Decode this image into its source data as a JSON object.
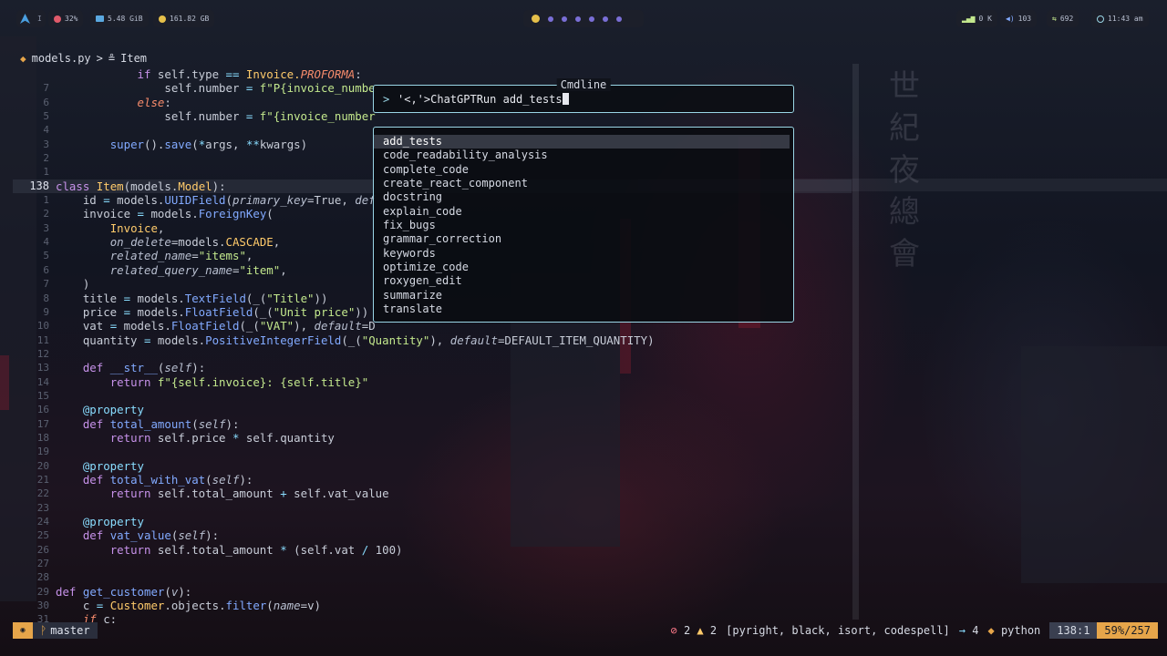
{
  "topbar": {
    "launcher_icon": "arch-logo",
    "workspace": "I",
    "cpu": "32%",
    "ram": "5.48 GiB",
    "disk": "161.82 GB",
    "net": "0 K",
    "volume": "103",
    "updates": "692",
    "clock": "11:43 am",
    "workspace_dots": 6
  },
  "winbar": {
    "file": "models.py",
    "separator": ">",
    "symbol_icon": "class-icon",
    "symbol": "Item"
  },
  "code_lines": [
    {
      "ln": "",
      "cur": false,
      "tokens": [
        [
          "            ",
          ""
        ],
        [
          "if",
          "kw"
        ],
        [
          " self.type ",
          ""
        ],
        [
          "==",
          "op"
        ],
        [
          " Invoice.",
          "cl"
        ],
        [
          "PROFORMA",
          "it"
        ],
        [
          ":",
          ""
        ]
      ]
    },
    {
      "ln": "7",
      "cur": false,
      "tokens": [
        [
          "                self.number ",
          ""
        ],
        [
          "=",
          "op"
        ],
        [
          " f\"P{invoice_numbe",
          "st"
        ]
      ]
    },
    {
      "ln": "6",
      "cur": false,
      "tokens": [
        [
          "            ",
          ""
        ],
        [
          "else",
          "it"
        ],
        [
          ":",
          ""
        ]
      ]
    },
    {
      "ln": "5",
      "cur": false,
      "tokens": [
        [
          "                self.number ",
          ""
        ],
        [
          "=",
          "op"
        ],
        [
          " f\"{invoice_number",
          "st"
        ]
      ]
    },
    {
      "ln": "4",
      "cur": false,
      "tokens": [
        [
          "",
          ""
        ]
      ]
    },
    {
      "ln": "3",
      "cur": false,
      "tokens": [
        [
          "        ",
          ""
        ],
        [
          "super",
          "fn"
        ],
        [
          "().",
          ""
        ],
        [
          "save",
          "fn"
        ],
        [
          "(",
          ""
        ],
        [
          "*",
          "op"
        ],
        [
          "args, ",
          ""
        ],
        [
          "**",
          "op"
        ],
        [
          "kwargs)",
          ""
        ]
      ]
    },
    {
      "ln": "2",
      "cur": false,
      "tokens": [
        [
          "",
          ""
        ]
      ]
    },
    {
      "ln": "1",
      "cur": false,
      "tokens": [
        [
          "",
          ""
        ]
      ]
    },
    {
      "ln": "138",
      "cur": true,
      "tokens": [
        [
          "class",
          "kw"
        ],
        [
          " ",
          ""
        ],
        [
          "Item",
          "cl"
        ],
        [
          "(models.",
          ""
        ],
        [
          "Model",
          "cl"
        ],
        [
          "):",
          ""
        ]
      ]
    },
    {
      "ln": "1",
      "cur": false,
      "tokens": [
        [
          "    id ",
          ""
        ],
        [
          "=",
          "op"
        ],
        [
          " models.",
          ""
        ],
        [
          "UUIDField",
          "fn"
        ],
        [
          "(",
          ""
        ],
        [
          "primary_key",
          "pa"
        ],
        [
          "=True, ",
          ""
        ],
        [
          "def",
          "pa"
        ]
      ]
    },
    {
      "ln": "2",
      "cur": false,
      "tokens": [
        [
          "    invoice ",
          ""
        ],
        [
          "=",
          "op"
        ],
        [
          " models.",
          ""
        ],
        [
          "ForeignKey",
          "fn"
        ],
        [
          "(",
          ""
        ]
      ]
    },
    {
      "ln": "3",
      "cur": false,
      "tokens": [
        [
          "        ",
          ""
        ],
        [
          "Invoice",
          "cl"
        ],
        [
          ",",
          ""
        ]
      ]
    },
    {
      "ln": "4",
      "cur": false,
      "tokens": [
        [
          "        ",
          ""
        ],
        [
          "on_delete",
          "pa"
        ],
        [
          "=models.",
          ""
        ],
        [
          "CASCADE",
          "cl"
        ],
        [
          ",",
          ""
        ]
      ]
    },
    {
      "ln": "5",
      "cur": false,
      "tokens": [
        [
          "        ",
          ""
        ],
        [
          "related_name",
          "pa"
        ],
        [
          "=",
          ""
        ],
        [
          "\"items\"",
          "st"
        ],
        [
          ",",
          ""
        ]
      ]
    },
    {
      "ln": "6",
      "cur": false,
      "tokens": [
        [
          "        ",
          ""
        ],
        [
          "related_query_name",
          "pa"
        ],
        [
          "=",
          ""
        ],
        [
          "\"item\"",
          "st"
        ],
        [
          ",",
          ""
        ]
      ]
    },
    {
      "ln": "7",
      "cur": false,
      "tokens": [
        [
          "    )",
          ""
        ]
      ]
    },
    {
      "ln": "8",
      "cur": false,
      "tokens": [
        [
          "    title ",
          ""
        ],
        [
          "=",
          "op"
        ],
        [
          " models.",
          ""
        ],
        [
          "TextField",
          "fn"
        ],
        [
          "(_(",
          ""
        ],
        [
          "\"Title\"",
          "st"
        ],
        [
          "))",
          ""
        ]
      ]
    },
    {
      "ln": "9",
      "cur": false,
      "tokens": [
        [
          "    price ",
          ""
        ],
        [
          "=",
          "op"
        ],
        [
          " models.",
          ""
        ],
        [
          "FloatField",
          "fn"
        ],
        [
          "(_(",
          ""
        ],
        [
          "\"Unit price\"",
          "st"
        ],
        [
          "))",
          ""
        ]
      ]
    },
    {
      "ln": "10",
      "cur": false,
      "tokens": [
        [
          "    vat ",
          ""
        ],
        [
          "=",
          "op"
        ],
        [
          " models.",
          ""
        ],
        [
          "FloatField",
          "fn"
        ],
        [
          "(_(",
          ""
        ],
        [
          "\"VAT\"",
          "st"
        ],
        [
          "), ",
          ""
        ],
        [
          "default",
          "pa"
        ],
        [
          "=D",
          ""
        ]
      ]
    },
    {
      "ln": "11",
      "cur": false,
      "tokens": [
        [
          "    quantity ",
          ""
        ],
        [
          "=",
          "op"
        ],
        [
          " models.",
          ""
        ],
        [
          "PositiveIntegerField",
          "fn"
        ],
        [
          "(_(",
          ""
        ],
        [
          "\"Quantity\"",
          "st"
        ],
        [
          "), ",
          ""
        ],
        [
          "default",
          "pa"
        ],
        [
          "=DEFAULT_ITEM_QUANTITY)",
          ""
        ]
      ]
    },
    {
      "ln": "12",
      "cur": false,
      "tokens": [
        [
          "",
          ""
        ]
      ]
    },
    {
      "ln": "13",
      "cur": false,
      "tokens": [
        [
          "    ",
          ""
        ],
        [
          "def",
          "kw"
        ],
        [
          " ",
          ""
        ],
        [
          "__str__",
          "fn"
        ],
        [
          "(",
          ""
        ],
        [
          "self",
          "pa"
        ],
        [
          "):",
          ""
        ]
      ]
    },
    {
      "ln": "14",
      "cur": false,
      "tokens": [
        [
          "        ",
          ""
        ],
        [
          "return",
          "kw"
        ],
        [
          " f\"{self.invoice}: {self.title}\"",
          "st"
        ]
      ]
    },
    {
      "ln": "15",
      "cur": false,
      "tokens": [
        [
          "",
          ""
        ]
      ]
    },
    {
      "ln": "16",
      "cur": false,
      "tokens": [
        [
          "    ",
          ""
        ],
        [
          "@property",
          "dc"
        ]
      ]
    },
    {
      "ln": "17",
      "cur": false,
      "tokens": [
        [
          "    ",
          ""
        ],
        [
          "def",
          "kw"
        ],
        [
          " ",
          ""
        ],
        [
          "total_amount",
          "fn"
        ],
        [
          "(",
          ""
        ],
        [
          "self",
          "pa"
        ],
        [
          "):",
          ""
        ]
      ]
    },
    {
      "ln": "18",
      "cur": false,
      "tokens": [
        [
          "        ",
          ""
        ],
        [
          "return",
          "kw"
        ],
        [
          " self.price ",
          ""
        ],
        [
          "*",
          "op"
        ],
        [
          " self.quantity",
          ""
        ]
      ]
    },
    {
      "ln": "19",
      "cur": false,
      "tokens": [
        [
          "",
          ""
        ]
      ]
    },
    {
      "ln": "20",
      "cur": false,
      "tokens": [
        [
          "    ",
          ""
        ],
        [
          "@property",
          "dc"
        ]
      ]
    },
    {
      "ln": "21",
      "cur": false,
      "tokens": [
        [
          "    ",
          ""
        ],
        [
          "def",
          "kw"
        ],
        [
          " ",
          ""
        ],
        [
          "total_with_vat",
          "fn"
        ],
        [
          "(",
          ""
        ],
        [
          "self",
          "pa"
        ],
        [
          "):",
          ""
        ]
      ]
    },
    {
      "ln": "22",
      "cur": false,
      "tokens": [
        [
          "        ",
          ""
        ],
        [
          "return",
          "kw"
        ],
        [
          " self.total_amount ",
          ""
        ],
        [
          "+",
          "op"
        ],
        [
          " self.vat_value",
          ""
        ]
      ]
    },
    {
      "ln": "23",
      "cur": false,
      "tokens": [
        [
          "",
          ""
        ]
      ]
    },
    {
      "ln": "24",
      "cur": false,
      "tokens": [
        [
          "    ",
          ""
        ],
        [
          "@property",
          "dc"
        ]
      ]
    },
    {
      "ln": "25",
      "cur": false,
      "tokens": [
        [
          "    ",
          ""
        ],
        [
          "def",
          "kw"
        ],
        [
          " ",
          ""
        ],
        [
          "vat_value",
          "fn"
        ],
        [
          "(",
          ""
        ],
        [
          "self",
          "pa"
        ],
        [
          "):",
          ""
        ]
      ]
    },
    {
      "ln": "26",
      "cur": false,
      "tokens": [
        [
          "        ",
          ""
        ],
        [
          "return",
          "kw"
        ],
        [
          " self.total_amount ",
          ""
        ],
        [
          "*",
          "op"
        ],
        [
          " (self.vat ",
          ""
        ],
        [
          "/",
          "op"
        ],
        [
          " 100)",
          ""
        ]
      ]
    },
    {
      "ln": "27",
      "cur": false,
      "tokens": [
        [
          "",
          ""
        ]
      ]
    },
    {
      "ln": "28",
      "cur": false,
      "tokens": [
        [
          "",
          ""
        ]
      ]
    },
    {
      "ln": "29",
      "cur": false,
      "tokens": [
        [
          "def",
          "kw"
        ],
        [
          " ",
          ""
        ],
        [
          "get_customer",
          "fn"
        ],
        [
          "(",
          ""
        ],
        [
          "v",
          "pa"
        ],
        [
          "):",
          ""
        ]
      ]
    },
    {
      "ln": "30",
      "cur": false,
      "tokens": [
        [
          "    c ",
          ""
        ],
        [
          "=",
          "op"
        ],
        [
          " ",
          ""
        ],
        [
          "Customer",
          "cl"
        ],
        [
          ".objects.",
          ""
        ],
        [
          "filter",
          "fn"
        ],
        [
          "(",
          ""
        ],
        [
          "name",
          "pa"
        ],
        [
          "=v)",
          ""
        ]
      ]
    },
    {
      "ln": "31",
      "cur": false,
      "tokens": [
        [
          "    ",
          ""
        ],
        [
          "if",
          "it"
        ],
        [
          " c:",
          ""
        ]
      ]
    }
  ],
  "cmdline": {
    "title": "Cmdline",
    "prompt": ">",
    "input": "'<,'>ChatGPTRun add_tests"
  },
  "completion": {
    "selected_index": 0,
    "items": [
      "add_tests",
      "code_readability_analysis",
      "complete_code",
      "create_react_component",
      "docstring",
      "explain_code",
      "fix_bugs",
      "grammar_correction",
      "keywords",
      "optimize_code",
      "roxygen_edit",
      "summarize",
      "translate"
    ]
  },
  "statusline": {
    "mode_icon": "circle-icon",
    "branch_icon": "git-branch-icon",
    "branch": "master",
    "errors": "2",
    "warnings": "2",
    "lsp": "[pyright, black, isort, codespell]",
    "indent": "4",
    "filetype": "python",
    "position": "138:1",
    "percent": "59%/257"
  },
  "background_text": [
    "世",
    "紀",
    "夜",
    "總",
    "會"
  ]
}
